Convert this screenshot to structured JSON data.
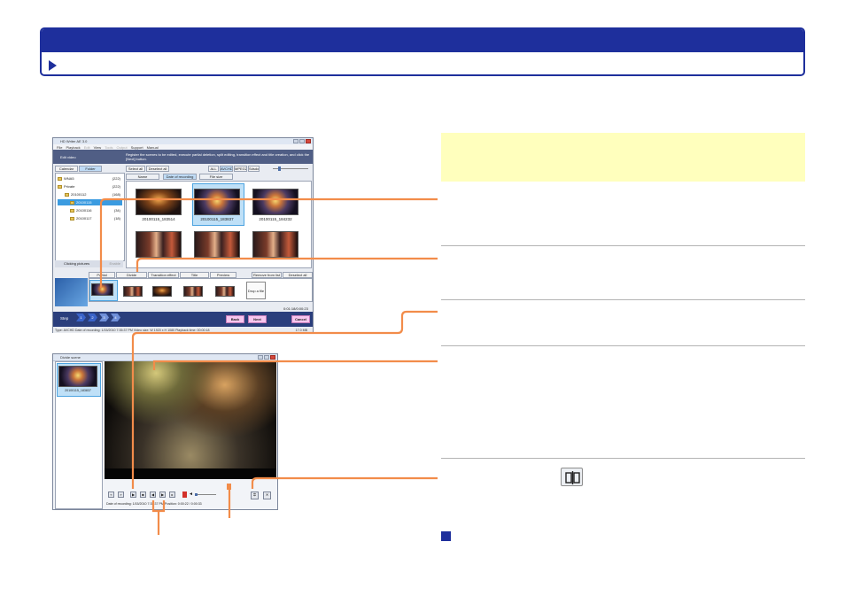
{
  "edit_window": {
    "title": "HD Writer AE 3.0",
    "menu": [
      "File",
      "Playback",
      "Edit",
      "View",
      "Tools",
      "Output",
      "Support",
      "Manual"
    ],
    "menu_dim": [
      false,
      false,
      true,
      false,
      true,
      true,
      false,
      false
    ],
    "banner_label": "Edit video",
    "banner_text": "Register the scenes to be edited, execute partial deletion, split editing, transition effect and title creation, and click the [Next] button.",
    "tabs": {
      "calendar": "Calendar",
      "folder": "Folder"
    },
    "tree": [
      {
        "label": "WNA5",
        "count": "(222)"
      },
      {
        "label": "Private",
        "count": "(222)"
      },
      {
        "label": "20100112",
        "count": "(168)"
      },
      {
        "label": "20100115",
        "count": ""
      },
      {
        "label": "20100116",
        "count": "(34)"
      },
      {
        "label": "20100117",
        "count": "(18)"
      }
    ],
    "left_bottom": {
      "label": "Clicking pictures",
      "btn": "Enable"
    },
    "toolbar": {
      "select_all": "Select all",
      "deselect_all": "Deselect all",
      "sort_tabs": [
        "Name",
        "Date of recording",
        "File size"
      ],
      "view_btns": [
        "ALL",
        "AVCHD",
        "MPEG2",
        "Sdsdo"
      ]
    },
    "thumbs": [
      {
        "caption": "20100115_183514"
      },
      {
        "caption": "20100115_183837"
      },
      {
        "caption": "20100115_184232"
      },
      {
        "caption": ""
      },
      {
        "caption": ""
      },
      {
        "caption": ""
      }
    ],
    "edit_tabs": [
      "Partial",
      "Divide",
      "Transition effect",
      "Title",
      "Preview",
      "Remove from list",
      "Deselect all"
    ],
    "drop_here": "Drop a file",
    "step": {
      "label": "Step",
      "numbers": [
        "1",
        "2",
        "3",
        "4"
      ]
    },
    "buttons": {
      "back": "Back",
      "next": "Next",
      "cancel": "Cancel"
    },
    "status": "Type: AVCHD  Date of recording: 1/15/2010 7:35:37 PM   Video size: W 1920 x H 1080  Playback time: 00:00:18",
    "status_right": "17.0 MB",
    "time_label": "0:01:18/0:00:23"
  },
  "divide_window": {
    "title": "Divide scene",
    "list_caption": "20100115_183837",
    "status": "Date of recording: 1/15/2010 7:35:37 PM     Position: 0:00:22 / 0:00:33"
  }
}
